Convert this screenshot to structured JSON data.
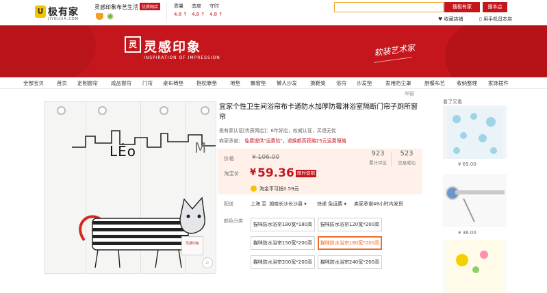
{
  "header": {
    "logo_box": "U",
    "logo_text": "极有家",
    "logo_sub": "JIYOUJIA.COM",
    "shop_name": "灵感印象布艺生活",
    "shop_badge": "优质网店",
    "ratings": [
      {
        "label": "质量",
        "value": "4.8 ↑"
      },
      {
        "label": "态度",
        "value": "4.8 ↑"
      },
      {
        "label": "守时",
        "value": "4.8 ↑"
      }
    ],
    "search_placeholder": "",
    "search_site_button": "搜极有家",
    "search_shop_button": "搜本店",
    "favorite_link": "♥ 收藏店铺",
    "mobile_link": "用手机逛本店"
  },
  "banner": {
    "brand_mark": "灵",
    "brand_name": "灵感印象",
    "brand_en": "INSPIRATION OF IMPRESSION",
    "slogan": "软装艺术家",
    "background": "#c4161c"
  },
  "nav": {
    "items": [
      "全部宝贝",
      "首页",
      "定制窗帘",
      "成品窗帘",
      "门帘",
      "桌布椅垫",
      "抱枕靠垫",
      "地垫",
      "飘窗垫",
      "懒人沙发",
      "换鞋凳",
      "浴帘",
      "沙发垫",
      "家用防尘罩",
      "厨餐布艺",
      "收纳整理",
      "家饰摆件"
    ]
  },
  "product": {
    "report": "举报",
    "title": "宜家个性卫生间浴帘布卡通防水加厚防霉淋浴室隔断门帘子厕所窗帘",
    "certification": "极有家认证[优质网店]：6年好店，权威认证，买退无忧",
    "promo_prefix": "商家承诺：",
    "promo_text": "免费提供\"运费险\"，退换都高获赔25元运费理赔",
    "price_label": "价格",
    "original_price": "¥ 106.00",
    "promo_price_label": "淘宝价",
    "currency": "¥",
    "current_price": "59.36",
    "promo_tag": "限时促销",
    "stats": [
      {
        "value": "923",
        "label": "累计评论"
      },
      {
        "value": "523",
        "label": "交易成功"
      }
    ],
    "coin_text": "淘金币可抵0.59元",
    "shipping_label": "配送",
    "shipping_from": "上海 至",
    "shipping_to": "湖南长沙长沙县 ▾",
    "shipping_method": "快递 免运费 ▾",
    "shipping_promise": "卖家承诺48小时内发货",
    "option_label": "颜色分类",
    "image_stamp": "灵感印象",
    "image_letters_left": "LÉo",
    "image_letters_right": "M",
    "zoom_icon": "⌕",
    "options": [
      {
        "label": "猫咪防水浴帘180宽*180高",
        "selected": false
      },
      {
        "label": "猫咪防水浴帘120宽*200高",
        "selected": false
      },
      {
        "label": "猫咪防水浴帘150宽*200高",
        "selected": false
      },
      {
        "label": "猫咪防水浴帘180宽*200高",
        "selected": true
      },
      {
        "label": "猫咪防水浴帘200宽*200高",
        "selected": false
      },
      {
        "label": "猫咪防水浴帘240宽*200高",
        "selected": false
      }
    ]
  },
  "sidebar": {
    "title": "看了又看",
    "items": [
      {
        "price": "¥ 69.00"
      },
      {
        "price": "¥ 36.00"
      }
    ]
  }
}
